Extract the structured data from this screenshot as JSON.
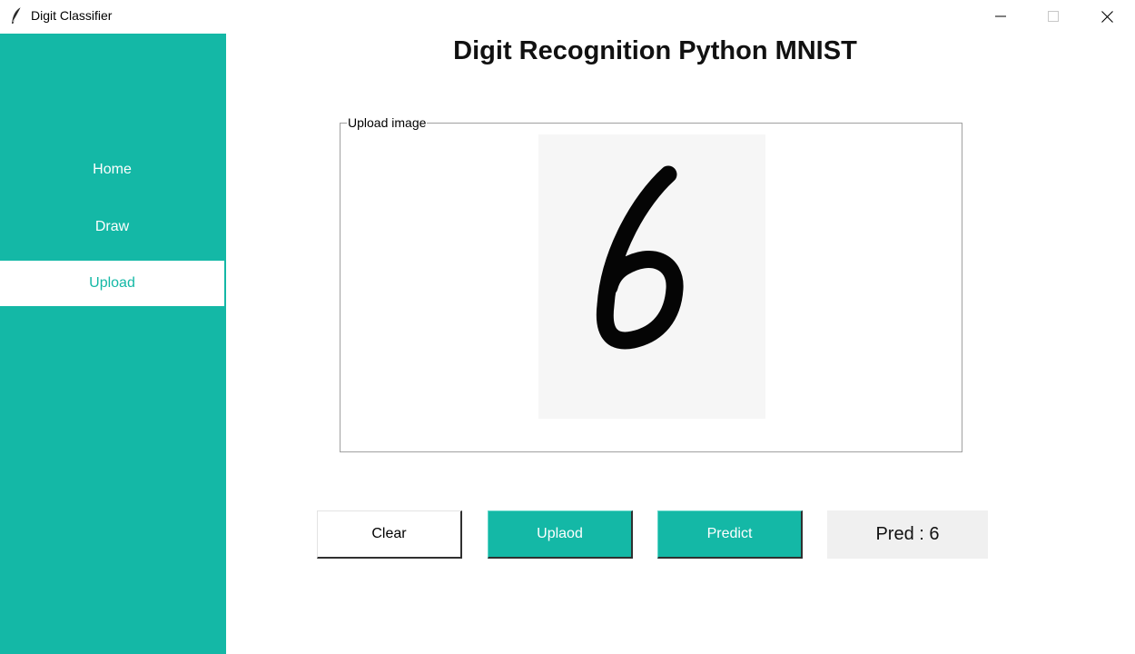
{
  "window": {
    "title": "Digit Classifier",
    "app_icon": "feather-icon",
    "controls": [
      "minimize-icon",
      "maximize-icon",
      "close-icon"
    ]
  },
  "sidebar": {
    "color": "#14b8a6",
    "items": [
      {
        "label": "Home",
        "active": false
      },
      {
        "label": "Draw",
        "active": false
      },
      {
        "label": "Upload",
        "active": true
      }
    ]
  },
  "main": {
    "title": "Digit Recognition Python MNIST",
    "upload_frame": {
      "label": "Upload image",
      "image": "handwritten digit 6"
    },
    "buttons": {
      "clear": "Clear",
      "upload": "Uplaod",
      "predict": "Predict"
    },
    "prediction": "Pred : 6"
  },
  "colors": {
    "accent": "#14b8a6",
    "prediction_bg": "#f0f0f0",
    "canvas_bg": "#f6f6f6"
  }
}
